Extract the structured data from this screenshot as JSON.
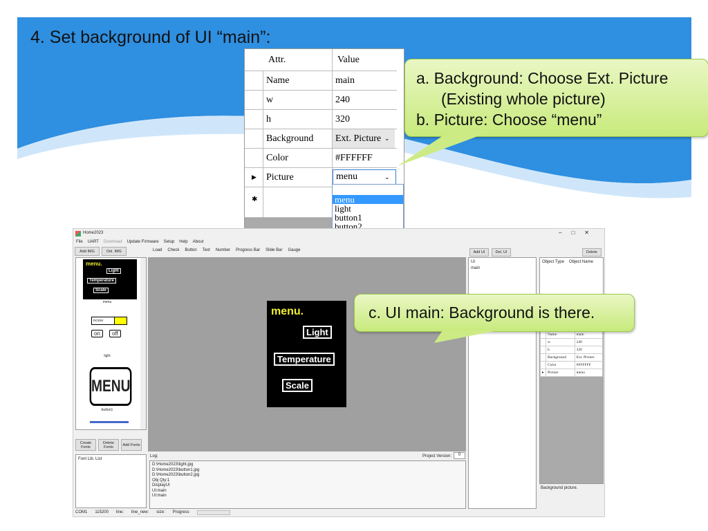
{
  "slide": {
    "title": "4. Set background of UI “main”:",
    "callout_ab": {
      "line1": "a. Background: Choose Ext. Picture",
      "line2": "(Existing whole picture)",
      "line3": "b. Picture: Choose “menu”"
    },
    "callout_c": "c. UI main: Background is there."
  },
  "attr_table": {
    "headers": [
      "Attr.",
      "Value"
    ],
    "rows": [
      [
        "Name",
        "main"
      ],
      [
        "w",
        "240"
      ],
      [
        "h",
        "320"
      ],
      [
        "Background",
        "Ext. Picture"
      ],
      [
        "Color",
        "#FFFFFF"
      ],
      [
        "Picture",
        "menu"
      ]
    ],
    "picture_options": [
      "menu",
      "light",
      "button1",
      "button2"
    ],
    "selected_option": "menu"
  },
  "app": {
    "title": "Home2023",
    "menu": [
      "File",
      "UART",
      "Download",
      "Update Firmware",
      "Setup",
      "Help",
      "About"
    ],
    "img_buttons": [
      "Add IMG",
      "Del. IMG"
    ],
    "toolbar": [
      "Load",
      "Check",
      "Button",
      "Text",
      "Number",
      "Progress Bar",
      "Slide Bar",
      "Gauge"
    ],
    "ui_buttons": [
      "Add UI",
      "Del. UI"
    ],
    "delete_label": "Delete",
    "image_list": {
      "menu_thumb": {
        "title": "menu.",
        "buttons": [
          "Light",
          "Temperature",
          "Scale"
        ]
      },
      "labels": [
        "menu",
        "light",
        "button1"
      ],
      "room": "ROOM",
      "on": "on",
      "off": "off",
      "menu_button": "MENU"
    },
    "preview": {
      "title": "menu.",
      "buttons": [
        "Light",
        "Temperature",
        "Scale"
      ]
    },
    "ui_list": {
      "header": "UI",
      "items": [
        "main"
      ]
    },
    "object_list": {
      "headers": [
        "Object Type",
        "Object Name"
      ]
    },
    "props": [
      [
        "Name",
        "main"
      ],
      [
        "w",
        "240"
      ],
      [
        "h",
        "320"
      ],
      [
        "Background",
        "Ext. Picture"
      ],
      [
        "Color",
        "#FFFFFF"
      ],
      [
        "Picture",
        "menu"
      ]
    ],
    "prop_desc": "Background picture.",
    "font_buttons": [
      "Create Fonts",
      "Delete Fonts",
      "Add Fonts"
    ],
    "font_list_label": "Font Lib. List",
    "log_label": "Log:",
    "project_version_label": "Project Version:",
    "project_version": "0",
    "log": [
      "D:\\Home2023\\light.jpg",
      "D:\\Home2023\\button1.jpg",
      "D:\\Home2023\\button2.jpg",
      "Obj Qty:1",
      "DisplayUI",
      "UI:main",
      "UI:main"
    ],
    "status": {
      "port": "COM1",
      "baud": "115200",
      "line": "line:",
      "line_new": "line_new:",
      "size": "size:",
      "progress": "Progress"
    }
  },
  "colors": {
    "wave": "#2f8fe0",
    "callout": "#c8ea7c",
    "canvas": "#a0a0a0",
    "highlight": "#3399ff"
  }
}
